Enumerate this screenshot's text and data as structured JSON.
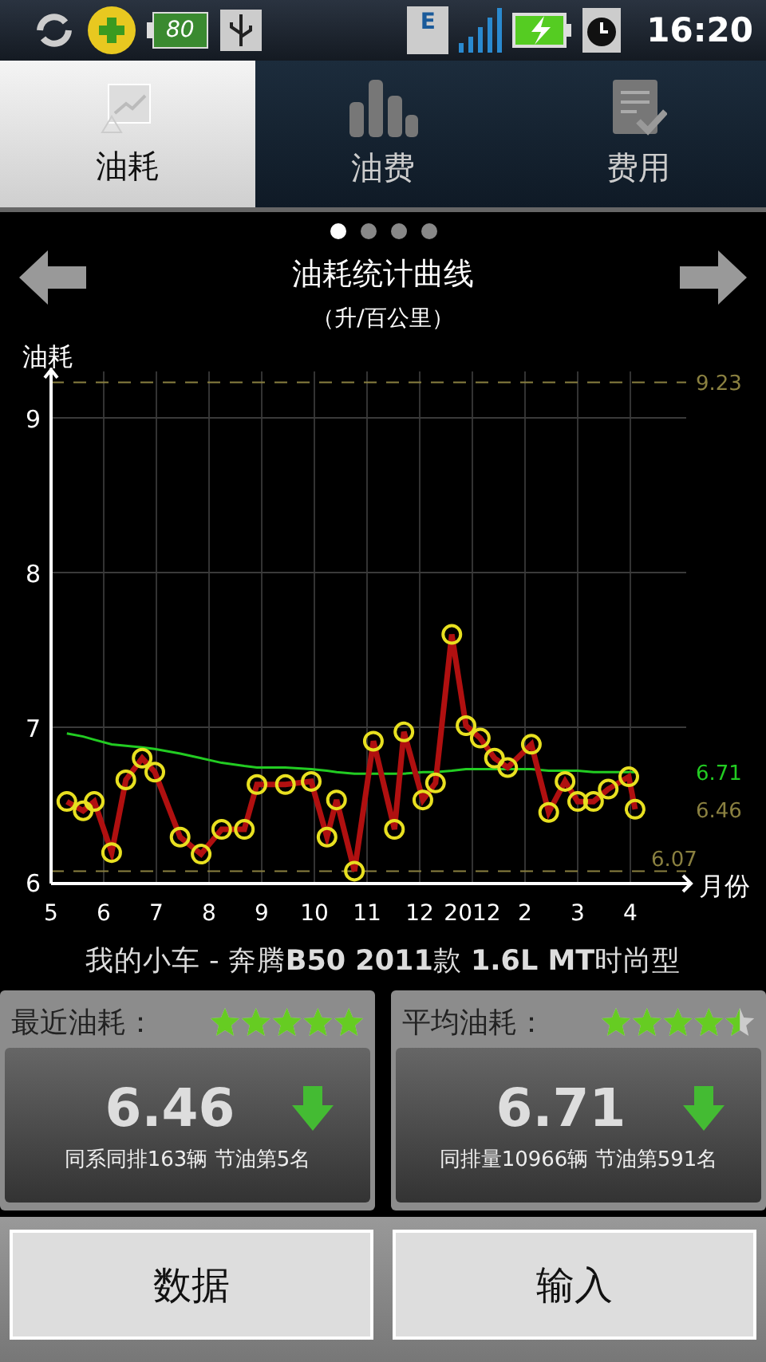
{
  "status_bar": {
    "battery_level_text": "80",
    "network": "E",
    "time": "16:20"
  },
  "tabs": [
    {
      "label": "油耗",
      "selected": true
    },
    {
      "label": "油费",
      "selected": false
    },
    {
      "label": "费用",
      "selected": false
    }
  ],
  "pages": [
    {
      "selected": true
    },
    {
      "selected": false
    },
    {
      "selected": false
    },
    {
      "selected": false
    }
  ],
  "title": "油耗统计曲线",
  "subtitle": "（升/百公里）",
  "chart_data": {
    "type": "line",
    "ylabel": "油耗",
    "xlabel": "月份",
    "grid": true,
    "ylim": [
      6,
      9.3
    ],
    "xlim": [
      5,
      17
    ],
    "yticks": [
      6,
      7,
      8,
      9
    ],
    "xticks": [
      5,
      6,
      7,
      8,
      9,
      10,
      11,
      12
    ],
    "x": [
      5.3,
      5.61,
      5.82,
      6.15,
      6.42,
      6.73,
      6.97,
      7.45,
      7.85,
      8.24,
      8.67,
      8.91,
      9.45,
      9.94,
      10.24,
      10.42,
      10.76,
      11.12,
      11.52,
      11.7,
      12.06,
      12.3,
      12.61,
      12.88,
      13.15,
      13.42,
      13.67,
      14.12,
      14.45,
      14.76,
      15.0,
      15.3,
      15.58,
      15.97,
      16.09
    ],
    "series": [
      {
        "color": "#b01010",
        "marker": "circle",
        "values": [
          6.52,
          6.46,
          6.52,
          6.19,
          6.66,
          6.8,
          6.71,
          6.29,
          6.18,
          6.34,
          6.34,
          6.63,
          6.63,
          6.65,
          6.29,
          6.53,
          6.07,
          6.91,
          6.34,
          6.97,
          6.53,
          6.64,
          7.6,
          7.01,
          6.93,
          6.8,
          6.74,
          6.89,
          6.45,
          6.65,
          6.52,
          6.52,
          6.6,
          6.68,
          6.47
        ]
      },
      {
        "color": "#22cc22",
        "values": [
          6.96,
          6.94,
          6.92,
          6.89,
          6.88,
          6.87,
          6.86,
          6.83,
          6.8,
          6.77,
          6.75,
          6.74,
          6.74,
          6.73,
          6.72,
          6.71,
          6.7,
          6.7,
          6.7,
          6.7,
          6.71,
          6.71,
          6.72,
          6.73,
          6.73,
          6.73,
          6.73,
          6.73,
          6.72,
          6.72,
          6.72,
          6.71,
          6.71,
          6.71,
          6.71
        ]
      }
    ],
    "ref_lines": [
      {
        "axis": "y",
        "value": 9.23,
        "label": "9.23"
      },
      {
        "axis": "y",
        "value": 6.07,
        "label": "6.07"
      }
    ],
    "annotations": [
      "6.71",
      "6.46"
    ]
  },
  "later_month_labels": [
    "2012",
    "2",
    "3",
    "4"
  ],
  "car_name": "我的小车 - 奔腾**B50  2011**款 **1.6L MT**时尚型",
  "cards": [
    {
      "label": "最近油耗：",
      "stars": 5,
      "value": "6.46",
      "note": "同系同排163辆  节油第5名"
    },
    {
      "label": "平均油耗：",
      "stars": 4.5,
      "value": "6.71",
      "note": "同排量10966辆  节油第591名"
    }
  ],
  "buttons": [
    "数据",
    "输入"
  ]
}
